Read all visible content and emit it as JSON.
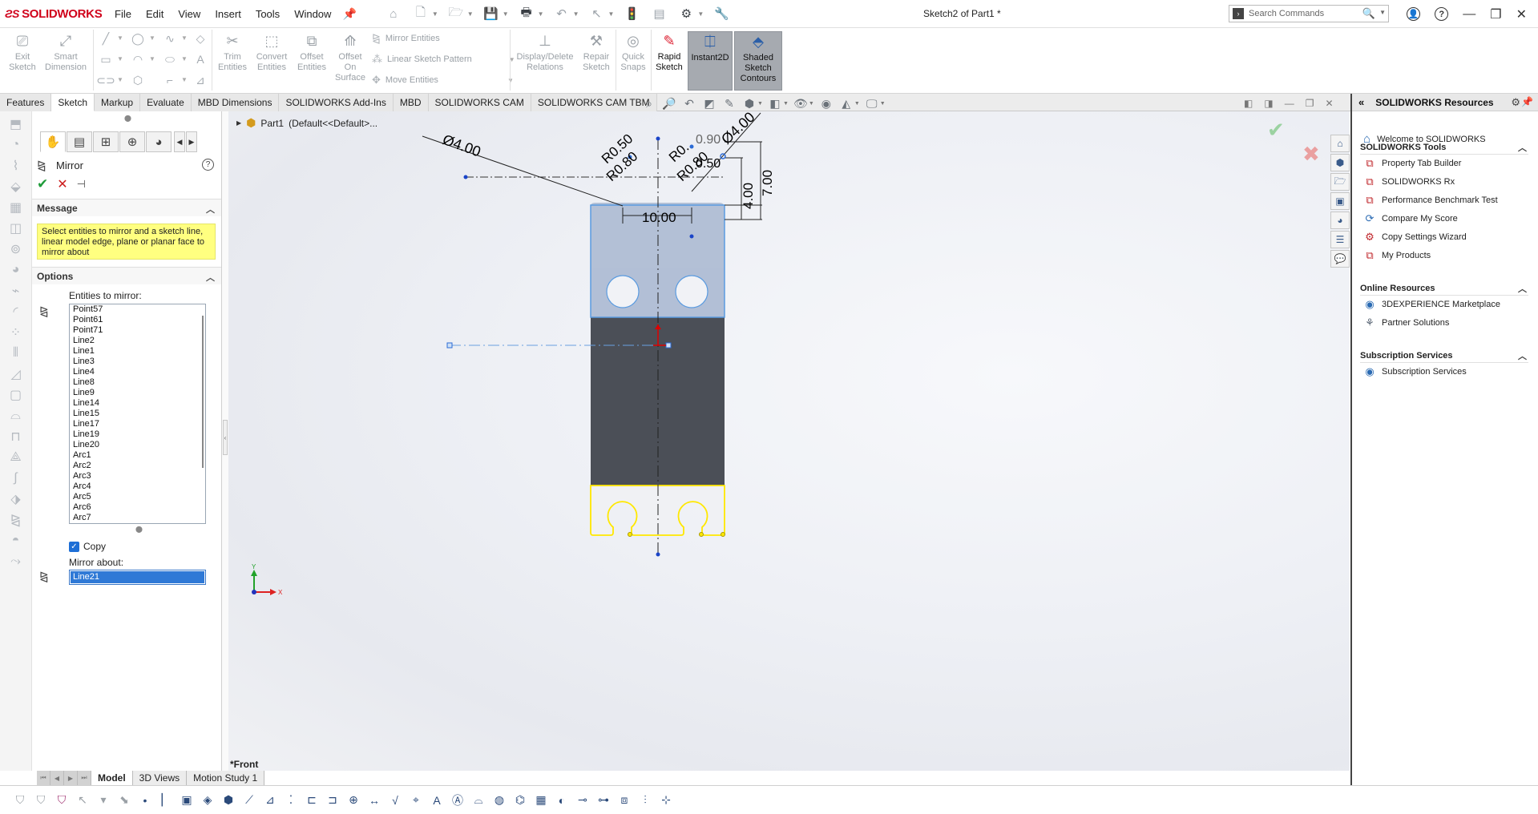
{
  "app": {
    "logo_brand": "SOLIDWORKS",
    "document_title": "Sketch2 of Part1 *",
    "menus": [
      "File",
      "Edit",
      "View",
      "Insert",
      "Tools",
      "Window"
    ],
    "search_placeholder": "Search Commands"
  },
  "command_manager": {
    "exit_sketch": [
      "Exit",
      "Sketch"
    ],
    "smart_dimension": [
      "Smart",
      "Dimension"
    ],
    "trim_entities": [
      "Trim",
      "Entities"
    ],
    "convert_entities": [
      "Convert",
      "Entities"
    ],
    "offset_entities": [
      "Offset",
      "Entities"
    ],
    "offset_on_surface": [
      "Offset",
      "On",
      "Surface"
    ],
    "mirror_entities": "Mirror Entities",
    "linear_sketch_pattern": "Linear Sketch Pattern",
    "move_entities": "Move Entities",
    "display_delete_relations": [
      "Display/Delete",
      "Relations"
    ],
    "repair_sketch": [
      "Repair",
      "Sketch"
    ],
    "quick_snaps": [
      "Quick",
      "Snaps"
    ],
    "rapid_sketch": [
      "Rapid",
      "Sketch"
    ],
    "instant2d": "Instant2D",
    "shaded_sketch_contours": [
      "Shaded",
      "Sketch",
      "Contours"
    ]
  },
  "tabs": [
    "Features",
    "Sketch",
    "Markup",
    "Evaluate",
    "MBD Dimensions",
    "SOLIDWORKS Add-Ins",
    "MBD",
    "SOLIDWORKS CAM",
    "SOLIDWORKS CAM TBM"
  ],
  "active_tab": "Sketch",
  "property_manager": {
    "title": "Mirror",
    "message_header": "Message",
    "message_text": "Select entities to mirror and a sketch line, linear model edge, plane or planar face to mirror about",
    "options_header": "Options",
    "entities_label": "Entities to mirror:",
    "entities": [
      "Point57",
      "Point61",
      "Point71",
      "Line2",
      "Line1",
      "Line3",
      "Line4",
      "Line8",
      "Line9",
      "Line14",
      "Line15",
      "Line17",
      "Line19",
      "Line20",
      "Arc1",
      "Arc2",
      "Arc3",
      "Arc4",
      "Arc5",
      "Arc6",
      "Arc7"
    ],
    "copy_label": "Copy",
    "copy_checked": true,
    "mirror_about_label": "Mirror about:",
    "mirror_about_value": "Line21"
  },
  "graphics": {
    "feature_tree_root": "Part1",
    "feature_tree_config": "(Default<<Default>...",
    "view_name": "*Front",
    "dimensions": {
      "dia_left": "Ø4.00",
      "dia_right": "Ø4.00",
      "r050": "R0.50",
      "r080_left": "R0.80",
      "r080_right": "R0.80",
      "r_small": "R0.",
      "d090": "0.90",
      "d050": "0.50",
      "width_10": "10.00",
      "height_4": "4.00",
      "height_7": "7.00"
    },
    "colors": {
      "body": "#4b4f57",
      "selected": "#b3c0d6",
      "highlight": "#ffe800",
      "accent_blue": "#2b6bd6"
    }
  },
  "bottom_tabs": [
    "Model",
    "3D Views",
    "Motion Study 1"
  ],
  "active_bottom_tab": "Model",
  "task_pane": {
    "title": "SOLIDWORKS Resources",
    "welcome": "Welcome to SOLIDWORKS",
    "groups": [
      {
        "name": "SOLIDWORKS Tools",
        "items": [
          "Property Tab Builder",
          "SOLIDWORKS Rx",
          "Performance Benchmark Test",
          "Compare My Score",
          "Copy Settings Wizard",
          "My Products"
        ]
      },
      {
        "name": "Online Resources",
        "items": [
          "3DEXPERIENCE Marketplace",
          "Partner Solutions"
        ]
      },
      {
        "name": "Subscription Services",
        "items": [
          "Subscription Services"
        ]
      }
    ]
  }
}
